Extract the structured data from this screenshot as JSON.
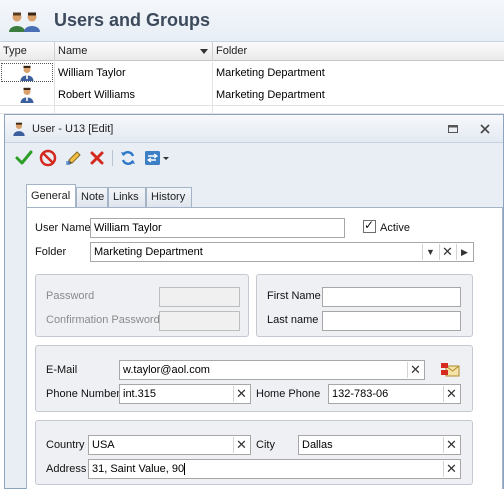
{
  "main": {
    "title": "Users and Groups",
    "columns": [
      "Type",
      "Name",
      "Folder"
    ],
    "rows": [
      {
        "name": "William Taylor",
        "folder": "Marketing Department",
        "selected": true
      },
      {
        "name": "Robert Williams",
        "folder": "Marketing Department",
        "selected": false
      }
    ]
  },
  "dialog": {
    "title": "User - U13 [Edit]",
    "toolbar": [
      "save-and-close",
      "cancel",
      "edit",
      "delete",
      "refresh",
      "actions"
    ],
    "tabs": [
      "General",
      "Note",
      "Links",
      "History"
    ],
    "active_tab": "General",
    "user_name_label": "User Name",
    "user_name_value": "William Taylor",
    "active_label": "Active",
    "active_checked": true,
    "folder_label": "Folder",
    "folder_value": "Marketing Department",
    "password_label": "Password",
    "confirm_password_label": "Confirmation Password",
    "first_name_label": "First Name",
    "first_name_value": "",
    "last_name_label": "Last name",
    "last_name_value": "",
    "email_label": "E-Mail",
    "email_value": "w.taylor@aol.com",
    "phone_label": "Phone Number",
    "phone_value": "int.315",
    "home_phone_label": "Home Phone",
    "home_phone_value": "132-783-06",
    "country_label": "Country",
    "country_value": "USA",
    "city_label": "City",
    "city_value": "Dallas",
    "address_label": "Address",
    "address_value": "31, Saint Value, 90"
  },
  "icons": {
    "save": "check-icon",
    "cancel": "no-entry-icon",
    "edit": "pencil-icon",
    "delete": "x-icon",
    "refresh": "refresh-icon",
    "actions": "actions-dropdown-icon",
    "clear": "clear-x-icon",
    "send_mail": "send-mail-icon"
  },
  "colors": {
    "accent": "#3d7fc4",
    "save_green": "#2e9e28",
    "delete_red": "#d42a1f"
  }
}
